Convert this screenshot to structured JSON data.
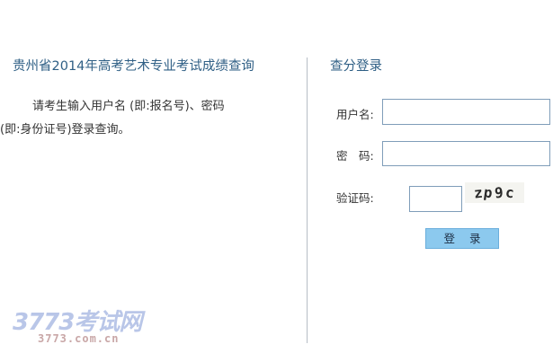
{
  "page": {
    "title": "贵州省2014年高考艺术专业考试成绩查询",
    "instructions_line1": "请考生输入用户名 (即:报名号)、密码",
    "instructions_line2": "(即:身份证号)登录查询。"
  },
  "login": {
    "title": "查分登录",
    "username_label": "用户名:",
    "username_value": "",
    "password_label": "密　码:",
    "password_value": "",
    "captcha_label": "验证码:",
    "captcha_value": "",
    "captcha_chars": [
      "z",
      "p",
      "9",
      "c"
    ],
    "submit_label": "登 录"
  },
  "watermark": {
    "logo_text": "3773考试网",
    "site": "3773.com.cn"
  },
  "colors": {
    "title_blue": "#2f5f85",
    "button_bg": "#8cc9ee",
    "input_border": "#7f9db9",
    "divider": "#b7bec6"
  }
}
